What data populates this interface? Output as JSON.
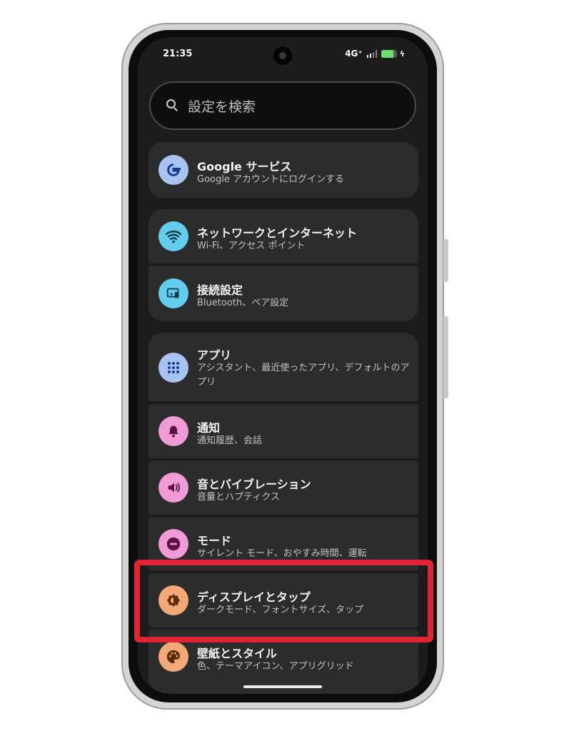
{
  "status_bar": {
    "time": "21:35",
    "network": "4G⁺",
    "battery_level": 0.8,
    "battery_color": "#6fdc72"
  },
  "search": {
    "placeholder": "設定を検索"
  },
  "groups": [
    {
      "items": [
        {
          "title": "Google サービス",
          "subtitle": "Google アカウントにログインする",
          "icon": "google-g-icon",
          "icon_bg": "#a8c3f2"
        }
      ]
    },
    {
      "items": [
        {
          "title": "ネットワークとインターネット",
          "subtitle": "Wi-Fi、アクセス ポイント",
          "icon": "wifi-icon",
          "icon_bg": "#62cdef"
        },
        {
          "title": "接続設定",
          "subtitle": "Bluetooth、ペア設定",
          "icon": "connected-devices-icon",
          "icon_bg": "#62cdef"
        }
      ]
    },
    {
      "items": [
        {
          "title": "アプリ",
          "subtitle": "アシスタント、最近使ったアプリ、デフォルトのアプリ",
          "icon": "apps-grid-icon",
          "icon_bg": "#a8c3f2"
        },
        {
          "title": "通知",
          "subtitle": "通知履歴、会話",
          "icon": "bell-icon",
          "icon_bg": "#f09ad6"
        },
        {
          "title": "音とバイブレーション",
          "subtitle": "音量とハプティクス",
          "icon": "volume-icon",
          "icon_bg": "#f09ad6"
        },
        {
          "title": "モード",
          "subtitle": "サイレント モード、おやすみ時間、運転",
          "icon": "do-not-disturb-icon",
          "icon_bg": "#f09ad6"
        },
        {
          "title": "ディスプレイとタップ",
          "subtitle": "ダークモード、フォントサイズ、タップ",
          "icon": "brightness-icon",
          "icon_bg": "#f3a878"
        },
        {
          "title": "壁紙とスタイル",
          "subtitle": "色、テーマアイコン、アプリグリッド",
          "icon": "palette-icon",
          "icon_bg": "#f3a878"
        }
      ]
    }
  ],
  "highlight_color": "#e02434"
}
